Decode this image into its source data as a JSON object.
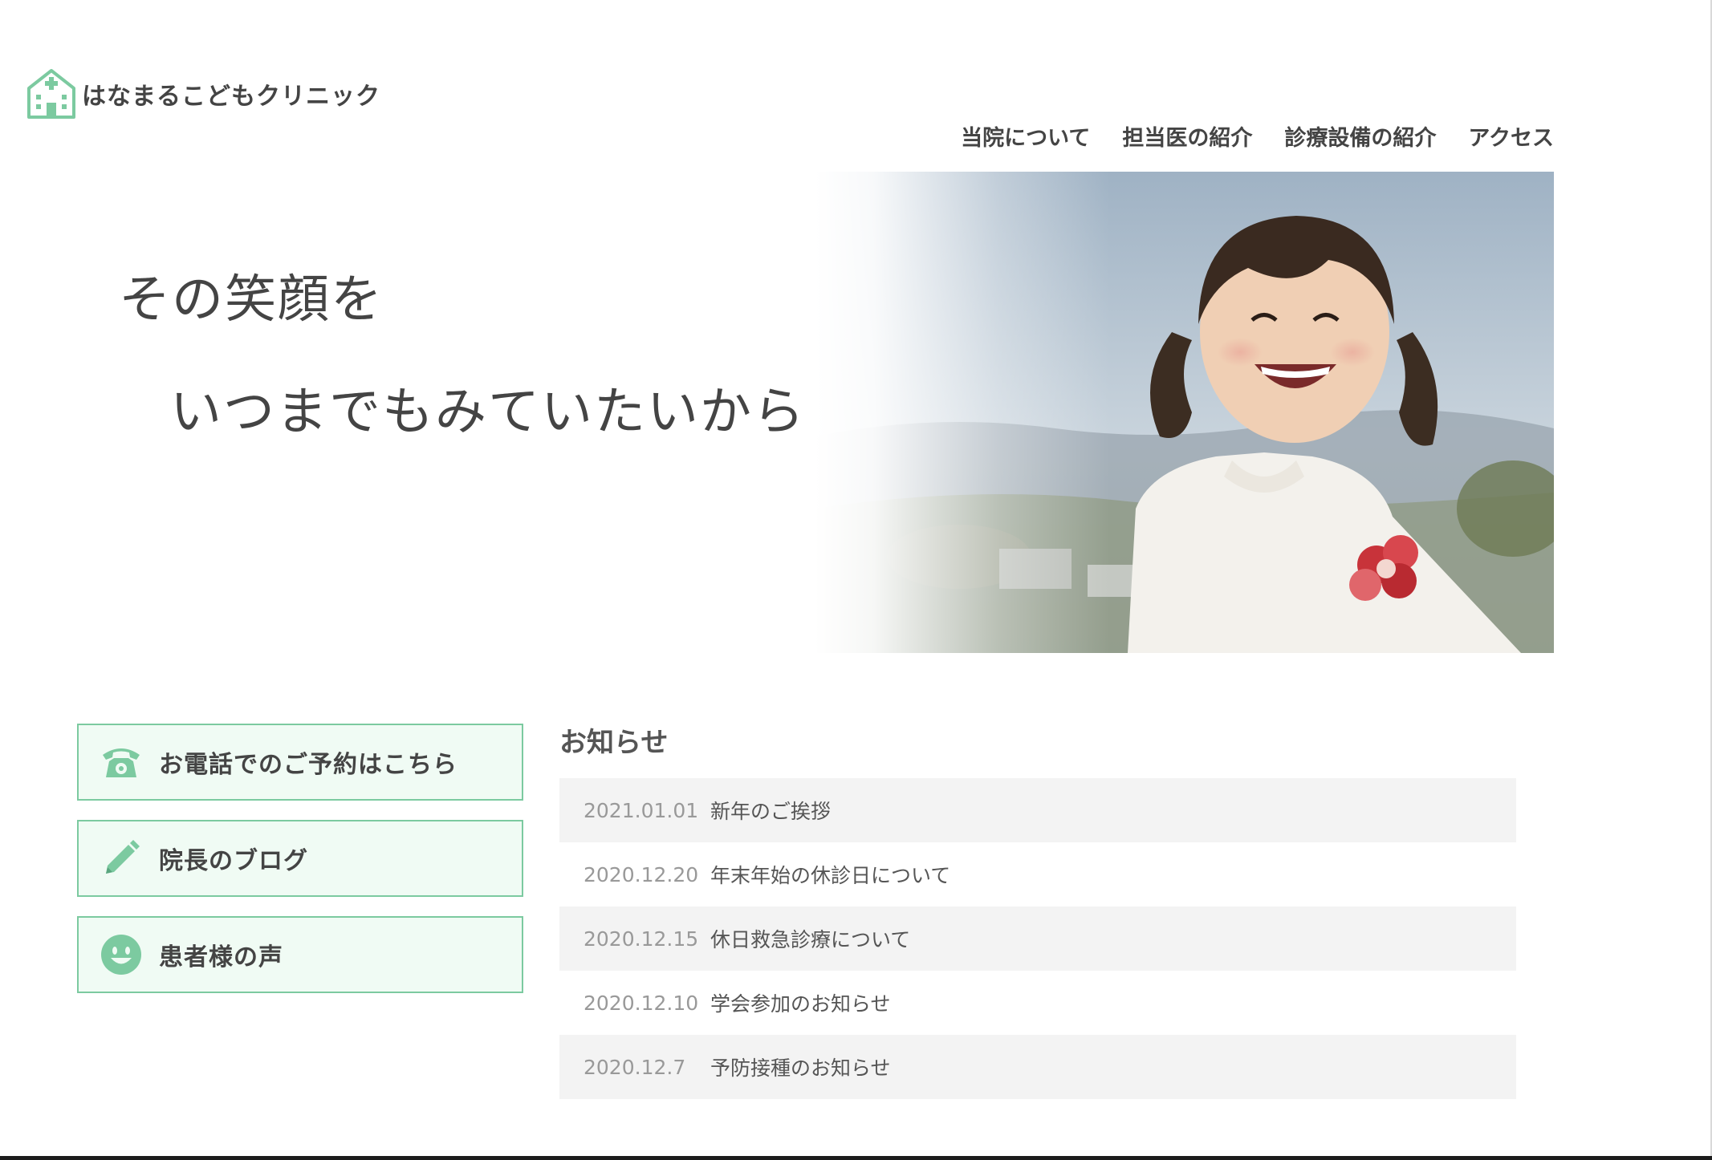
{
  "site": {
    "name": "はなまるこどもクリニック",
    "brand_color": "#7ccaa0",
    "logo_icon": "clinic-house-icon"
  },
  "nav": {
    "items": [
      {
        "label": "当院について"
      },
      {
        "label": "担当医の紹介"
      },
      {
        "label": "診療設備の紹介"
      },
      {
        "label": "アクセス"
      }
    ]
  },
  "hero": {
    "line1": "その笑顔を",
    "line2": "いつまでもみていたいから",
    "image": "smiling-girl-photo"
  },
  "side_buttons": [
    {
      "label": "お電話でのご予約はこちら",
      "icon": "telephone-icon"
    },
    {
      "label": "院長のブログ",
      "icon": "pencil-icon"
    },
    {
      "label": "患者様の声",
      "icon": "smiley-icon"
    }
  ],
  "news": {
    "title": "お知らせ",
    "items": [
      {
        "date": "2021.01.01",
        "text": "新年のご挨拶"
      },
      {
        "date": "2020.12.20",
        "text": "年末年始の休診日について"
      },
      {
        "date": "2020.12.15",
        "text": "休日救急診療について"
      },
      {
        "date": "2020.12.10",
        "text": "学会参加のお知らせ"
      },
      {
        "date": "2020.12.7",
        "text": "予防接種のお知らせ"
      }
    ]
  }
}
